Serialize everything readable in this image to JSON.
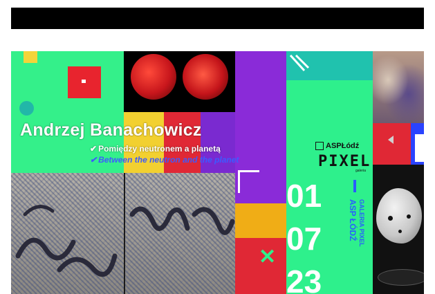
{
  "banner": {
    "title": "Andrzej Banachowicz",
    "subtitle_pl": "Pomiędzy neutronem a planetą",
    "subtitle_en": "Between the neutron and the planet",
    "check_glyph": "✔",
    "logo_text": "ASPŁódź",
    "pixel_text": "PIXEL",
    "pixel_sub": "galeria",
    "dates": [
      "01",
      "07",
      "23"
    ],
    "vertical_1": "GALERIA PIXEL",
    "vertical_2": "ASP ŁÓDŹ",
    "close_glyph": "✕"
  },
  "colors": {
    "green": "#2ef08c",
    "purple": "#8a2bd8",
    "red": "#e02835",
    "yellow": "#f2d030",
    "blue": "#2a43ff",
    "teal": "#20c2ae",
    "black_bar": "#000000"
  },
  "icons": [
    "asp-logo-icon",
    "checkmark-icon",
    "close-icon",
    "corner-bracket-icon",
    "arrow-left-icon"
  ]
}
